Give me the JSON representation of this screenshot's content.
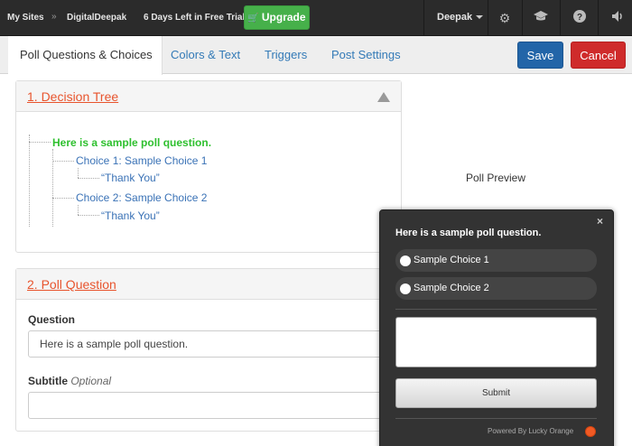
{
  "topbar": {
    "my_sites": "My Sites",
    "separator": "»",
    "site_name": "DigitalDeepak",
    "trial": "6 Days Left in Free Trial",
    "upgrade_label": "Upgrade",
    "user_name": "Deepak",
    "icons": [
      "gear-icon",
      "graduation-cap-icon",
      "help-icon",
      "volume-icon"
    ]
  },
  "tabs": [
    {
      "label": "Poll Questions & Choices",
      "active": true
    },
    {
      "label": "Colors & Text",
      "active": false
    },
    {
      "label": "Triggers",
      "active": false
    },
    {
      "label": "Post Settings",
      "active": false
    }
  ],
  "actions": {
    "save": "Save",
    "cancel": "Cancel"
  },
  "decision_tree": {
    "title": "1. Decision Tree",
    "question": "Here is a sample poll question.",
    "choices": [
      {
        "label": "Choice 1: Sample Choice 1",
        "reply": "“Thank You”"
      },
      {
        "label": "Choice 2: Sample Choice 2",
        "reply": "“Thank You”"
      }
    ]
  },
  "poll_question": {
    "title": "2. Poll Question",
    "question_label": "Question",
    "question_value": "Here is a sample poll question.",
    "subtitle_label": "Subtitle",
    "subtitle_optional": "Optional",
    "subtitle_value": ""
  },
  "preview": {
    "label": "Poll Preview",
    "close": "×",
    "question": "Here is a sample poll question.",
    "choices": [
      "Sample Choice 1",
      "Sample Choice 2"
    ],
    "submit": "Submit",
    "powered_by": "Powered By Lucky Orange"
  },
  "colors": {
    "accent_title": "#e8542d",
    "tree_question": "#2fc02f",
    "tree_choice": "#3a72b6",
    "upgrade_green": "#46b04a",
    "save_blue": "#2265a8",
    "cancel_red": "#cf2b2b"
  }
}
